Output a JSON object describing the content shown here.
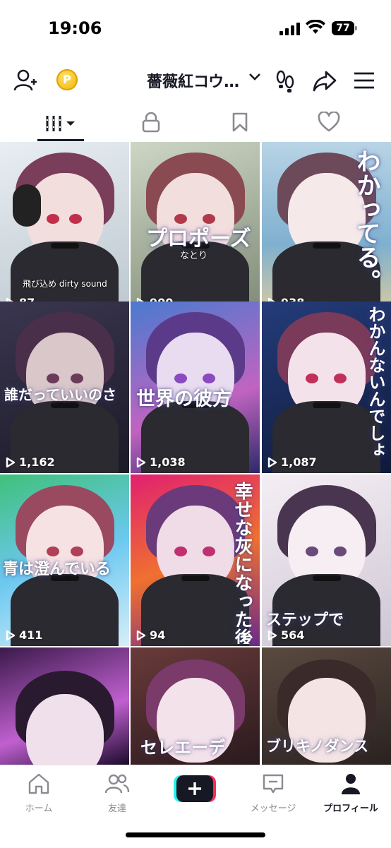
{
  "status_bar": {
    "time": "19:06",
    "battery": "77"
  },
  "header": {
    "title": "薔薇紅コウ…",
    "coin_symbol": "P"
  },
  "tabs": [
    "videos-tab",
    "private-tab",
    "saved-tab",
    "liked-tab"
  ],
  "videos": [
    {
      "views": "87",
      "caption": "",
      "sub": "飛び込め dirty sound"
    },
    {
      "views": "900",
      "caption": "プロポーズ",
      "sub": "なとり"
    },
    {
      "views": "938",
      "caption": "わかってる。",
      "sub": ""
    },
    {
      "views": "1,162",
      "caption": "誰だっていいのさ",
      "sub": ""
    },
    {
      "views": "1,038",
      "caption": "世界の彼方",
      "sub": ""
    },
    {
      "views": "1,087",
      "caption": "わかんないんでしょ",
      "sub": ""
    },
    {
      "views": "411",
      "caption": "青は澄んでいる",
      "sub": ""
    },
    {
      "views": "94",
      "caption": "幸せな灰になった後",
      "sub": ""
    },
    {
      "views": "564",
      "caption": "ステップで",
      "sub": ""
    },
    {
      "views": "",
      "caption": "",
      "sub": ""
    },
    {
      "views": "",
      "caption": "セレエーデ",
      "sub": ""
    },
    {
      "views": "",
      "caption": "ブリキノダンス",
      "sub": ""
    }
  ],
  "bottom_nav": {
    "home": "ホーム",
    "friends": "友達",
    "inbox": "メッセージ",
    "profile": "プロフィール"
  },
  "colors": {
    "accent_cyan": "#25f4ee",
    "accent_red": "#fe2c55",
    "text": "#161823",
    "muted": "#8a8b91"
  }
}
